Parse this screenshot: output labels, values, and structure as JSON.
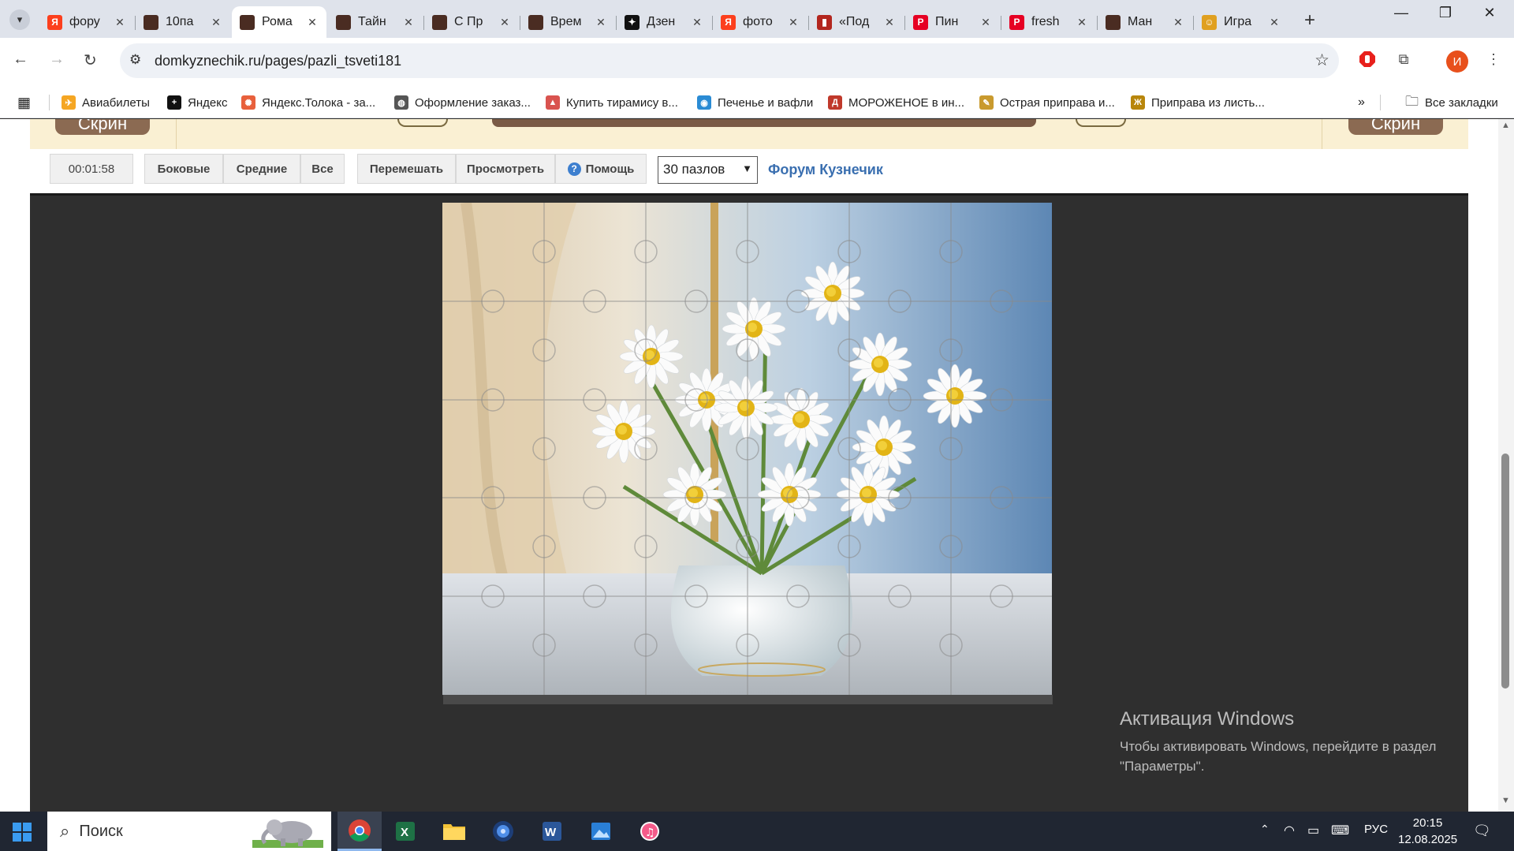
{
  "browser": {
    "tabs": [
      {
        "title": "фору",
        "favicon": "yandex-icon",
        "color": "#fc3f1d",
        "glyph": "Я"
      },
      {
        "title": "10па",
        "favicon": "kuznechik-icon",
        "color": "#4a2c22",
        "glyph": ""
      },
      {
        "title": "Рома",
        "favicon": "kuznechik-icon",
        "color": "#4a2c22",
        "glyph": "",
        "active": true
      },
      {
        "title": "Тайн",
        "favicon": "kuznechik-icon",
        "color": "#4a2c22",
        "glyph": ""
      },
      {
        "title": "С Пр",
        "favicon": "kuznechik-icon",
        "color": "#4a2c22",
        "glyph": ""
      },
      {
        "title": "Врем",
        "favicon": "kuznechik-icon",
        "color": "#4a2c22",
        "glyph": ""
      },
      {
        "title": "Дзен",
        "favicon": "dzen-icon",
        "color": "#111111",
        "glyph": "✦"
      },
      {
        "title": "фото",
        "favicon": "yandex-icon",
        "color": "#fc3f1d",
        "glyph": "Я"
      },
      {
        "title": "«Под",
        "favicon": "book-icon",
        "color": "#b3261e",
        "glyph": "▮"
      },
      {
        "title": "Пин",
        "favicon": "pinterest-icon",
        "color": "#e60023",
        "glyph": "P"
      },
      {
        "title": "fresh",
        "favicon": "pinterest-icon",
        "color": "#e60023",
        "glyph": "P"
      },
      {
        "title": "Ман",
        "favicon": "kuznechik-icon",
        "color": "#4a2c22",
        "glyph": ""
      },
      {
        "title": "Игра",
        "favicon": "game-icon",
        "color": "#e0a020",
        "glyph": "☺"
      }
    ],
    "url": "domkyznechik.ru/pages/pazli_tsveti181",
    "profile_initial": "И",
    "bookmarks": [
      {
        "label": "Авиабилеты",
        "icon": "flight-icon",
        "color": "#f5a623",
        "glyph": "✈"
      },
      {
        "label": "Яндекс",
        "icon": "yandex-plus-icon",
        "color": "#111111",
        "glyph": "+"
      },
      {
        "label": "Яндекс.Толока - за...",
        "icon": "toloka-icon",
        "color": "#e8603c",
        "glyph": "✺"
      },
      {
        "label": "Оформление заказ...",
        "icon": "globe-icon",
        "color": "#555555",
        "glyph": "◍"
      },
      {
        "label": "Купить тирамису в...",
        "icon": "tiramisu-icon",
        "color": "#d9534f",
        "glyph": "▲"
      },
      {
        "label": "Печенье и вафли",
        "icon": "cookie-icon",
        "color": "#2a8bd4",
        "glyph": "◉"
      },
      {
        "label": "МОРОЖЕНОЕ в ин...",
        "icon": "icecream-icon",
        "color": "#c0392b",
        "glyph": "Д"
      },
      {
        "label": "Острая приправа и...",
        "icon": "spice-icon",
        "color": "#c99a2e",
        "glyph": "✎"
      },
      {
        "label": "Приправа из листь...",
        "icon": "herb-icon",
        "color": "#b8860b",
        "glyph": "Ж"
      }
    ],
    "all_bookmarks_label": "Все закладки"
  },
  "page": {
    "timer": "00:01:58",
    "buttons": {
      "sides": "Боковые",
      "middle": "Средние",
      "all": "Все",
      "shuffle": "Перемешать",
      "preview": "Просмотреть",
      "help": "Помощь"
    },
    "pieces_select": "30 пазлов",
    "forum_link": "Форум Кузнечик",
    "banner_left": "Скрин",
    "banner_right": "Скрин"
  },
  "watermark": {
    "title": "Активация Windows",
    "text": "Чтобы активировать Windows, перейдите в раздел \"Параметры\"."
  },
  "taskbar": {
    "search_placeholder": "Поиск",
    "language": "РУС",
    "time": "20:15",
    "date": "12.08.2025"
  }
}
